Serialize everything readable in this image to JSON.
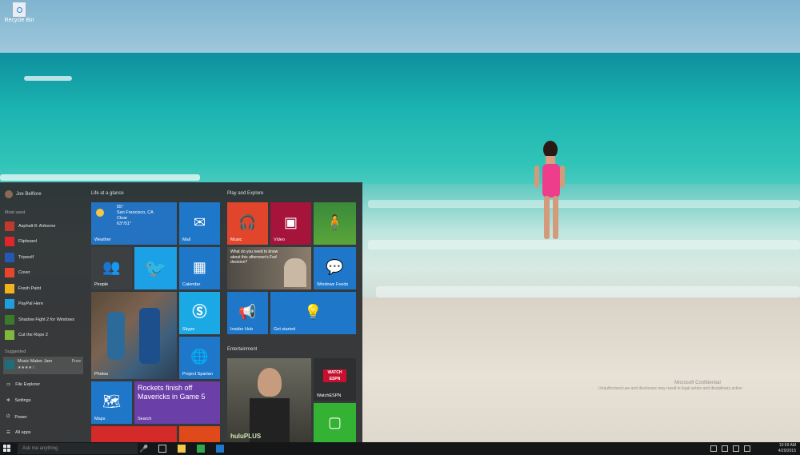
{
  "desktop": {
    "recycle_bin_label": "Recycle Bin",
    "watermark_title": "Microsoft Confidential",
    "watermark_text": "Unauthorized use and disclosure may result in legal action and disciplinary action"
  },
  "start": {
    "user_name": "Joe Belfiore",
    "most_used_label": "Most used",
    "most_used": [
      {
        "label": "Asphalt 8: Airborne",
        "color": "#c0392b"
      },
      {
        "label": "Flipboard",
        "color": "#e0262b"
      },
      {
        "label": "Tripwolf",
        "color": "#2458b3"
      },
      {
        "label": "Cover",
        "color": "#e8452c"
      },
      {
        "label": "Fresh Paint",
        "color": "#f2b21b"
      },
      {
        "label": "PayPal Here",
        "color": "#1ea0e0"
      },
      {
        "label": "Shadow Fight 2 for Windows",
        "color": "#3a7a2a"
      },
      {
        "label": "Cut the Rope 2",
        "color": "#7fb83a"
      }
    ],
    "suggested_label": "Suggested",
    "suggested": {
      "label": "Music Maker Jam",
      "free": "Free",
      "stars": "★★★★☆"
    },
    "system": {
      "file_explorer": "File Explorer",
      "settings": "Settings",
      "power": "Power",
      "all_apps": "All apps"
    },
    "groups": {
      "life": "Life at a glance",
      "play": "Play and Explore",
      "entertainment": "Entertainment"
    },
    "weather": {
      "temp": "55°",
      "city": "San Francisco, CA",
      "cond": "Clear",
      "range": "63°/51°",
      "label": "Weather"
    },
    "tiles": {
      "mail": "Mail",
      "people": "People",
      "twitter": "",
      "calendar": "Calendar",
      "photos": "Photos",
      "skype": "Skype",
      "spartan": "Project Spartan",
      "maps": "Maps",
      "search_headline": "Rockets finish off Mavericks in Game 5",
      "search": "Search",
      "music": "Music",
      "video": "Video",
      "feeds_text": "What do you need to know about this afternoon's Fed decision?",
      "windows_feeds": "Windows Feeds",
      "insider": "Insider Hub",
      "getstarted": "Get started",
      "watchespn_logo": "WATCH ESPN",
      "watchespn": "WatchESPN",
      "hulu": "huluPLUS"
    }
  },
  "taskbar": {
    "search_placeholder": "Ask me anything",
    "time": "10:59 AM",
    "date": "4/29/2015"
  }
}
